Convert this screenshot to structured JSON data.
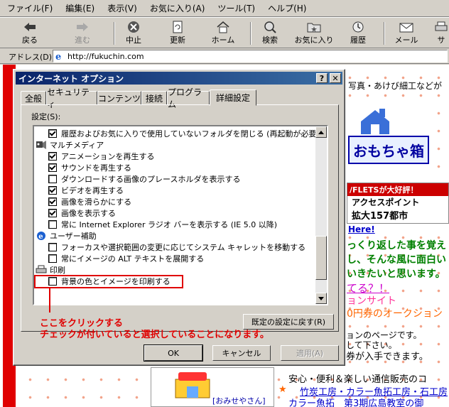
{
  "menubar": {
    "items": [
      "ファイル(F)",
      "編集(E)",
      "表示(V)",
      "お気に入り(A)",
      "ツール(T)",
      "ヘルプ(H)"
    ]
  },
  "toolbar": {
    "back": "戻る",
    "forward": "進む",
    "stop": "中止",
    "refresh": "更新",
    "home": "ホーム",
    "search": "検索",
    "favorites": "お気に入り",
    "history": "履歴",
    "mail": "メール",
    "print_partial": "サ"
  },
  "address": {
    "label": "アドレス(D)",
    "url": "http://fukuchin.com"
  },
  "page": {
    "top_text": "写真・あけび細工などが",
    "omocha": "おもちゃ箱",
    "flets_top": "/FLETSが大好評！",
    "flets_line1": "アクセスポイント",
    "flets_line2": "拡大157都市",
    "here_link": "Here!",
    "green1": "っくり返した事を覚え",
    "green2": "し、そんな風に面白い",
    "green3": "いきたいと思います。",
    "pink1": "てる？！",
    "pink2": "ョンサイト",
    "orange": "0円券のオークション",
    "black1": "ョンのページです。",
    "black2": "して下さい。",
    "black3": "券が入手できます。",
    "bottom1": "安心・便利＆楽しい通信販売のコ",
    "bottom2": "竹炭工房・カラー魚拓工房・石工房",
    "bottom3": "カラー魚拓　第3期広島教室の御",
    "omise": "[おみせやさん]"
  },
  "dialog": {
    "title": "インターネット オプション",
    "tabs": [
      "全般",
      "セキュリティ",
      "コンテンツ",
      "接続",
      "プログラム",
      "詳細設定"
    ],
    "active_tab": "詳細設定",
    "settings_label": "設定(S):",
    "rows": [
      {
        "type": "check",
        "checked": true,
        "label": "履歴およびお気に入りで使用していないフォルダを閉じる (再起動が必要)"
      },
      {
        "type": "category",
        "icon": "multimedia-icon",
        "label": "マルチメディア"
      },
      {
        "type": "check",
        "checked": true,
        "label": "アニメーションを再生する"
      },
      {
        "type": "check",
        "checked": true,
        "label": "サウンドを再生する"
      },
      {
        "type": "check",
        "checked": false,
        "label": "ダウンロードする画像のプレースホルダを表示する"
      },
      {
        "type": "check",
        "checked": true,
        "label": "ビデオを再生する"
      },
      {
        "type": "check",
        "checked": true,
        "label": "画像を滑らかにする"
      },
      {
        "type": "check",
        "checked": true,
        "label": "画像を表示する"
      },
      {
        "type": "check",
        "checked": false,
        "label": "常に Internet Explorer ラジオ バーを表示する (IE 5.0 以降)"
      },
      {
        "type": "category",
        "icon": "accessibility-icon",
        "label": "ユーザー補助"
      },
      {
        "type": "check",
        "checked": false,
        "label": "フォーカスや選択範囲の変更に応じてシステム キャレットを移動する"
      },
      {
        "type": "check",
        "checked": false,
        "label": "常にイメージの ALT テキストを展開する"
      },
      {
        "type": "category",
        "icon": "printer-icon",
        "label": "印刷"
      },
      {
        "type": "check",
        "checked": false,
        "label": "背景の色とイメージを印刷する"
      }
    ],
    "reset_button": "既定の設定に戻す(R)",
    "ok": "OK",
    "cancel": "キャンセル",
    "apply": "適用(A)"
  },
  "annotation": {
    "line1": "ここをクリックする",
    "line2": "チェックが付いていると選択していることになります。"
  },
  "colors": {
    "annotation": "#e00000",
    "title_start": "#0a246a",
    "title_end": "#3a6ea5"
  }
}
